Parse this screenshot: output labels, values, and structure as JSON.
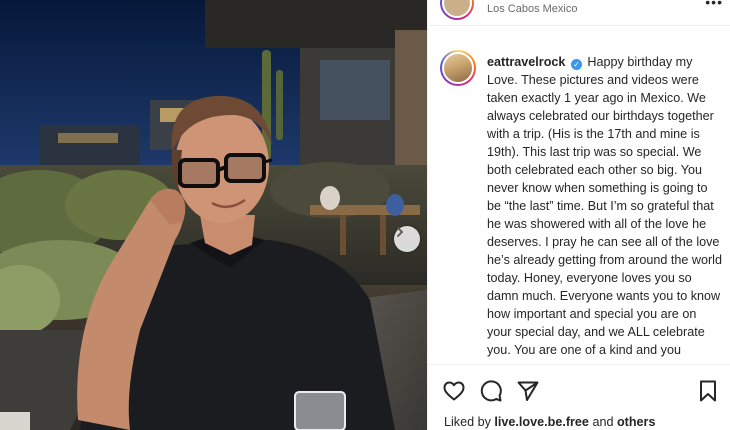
{
  "post": {
    "location": "Los Cabos Mexico",
    "username": "eattravelrock",
    "verified": true,
    "caption": "Happy birthday my Love. These pictures and videos were taken exactly 1 year ago in Mexico. We always celebrated our birthdays together with a trip. (His is the 17th and mine is 19th). This last trip was so special. We both celebrated each other so big. You never know when something is going to be “the last” time. But I’m so grateful that he was showered with all of the love he deserves. I pray he can see all of the love he’s already getting from around the world today. Honey, everyone loves you so damn much. Everyone wants you to know how important and special you are on your special day, and we ALL celebrate you. You are one of a kind and you certainly made my world go ‘round. I love you more than anything and miss",
    "liked_by_prefix": "Liked by",
    "liked_by_user": "live.love.be.free",
    "liked_by_and": "and",
    "liked_by_others": "others"
  },
  "icons": {
    "header_menu": "more-icon",
    "carousel": "chevron-right-icon",
    "like": "heart-icon",
    "comment": "comment-icon",
    "share": "paper-plane-icon",
    "save": "bookmark-icon"
  },
  "colors": {
    "verified": "#3897f0",
    "story_ring": [
      "#feda75",
      "#fa7e1e",
      "#d62976",
      "#962fbf",
      "#4f5bd5"
    ],
    "text": "#262626",
    "muted": "#6b6b6b"
  }
}
